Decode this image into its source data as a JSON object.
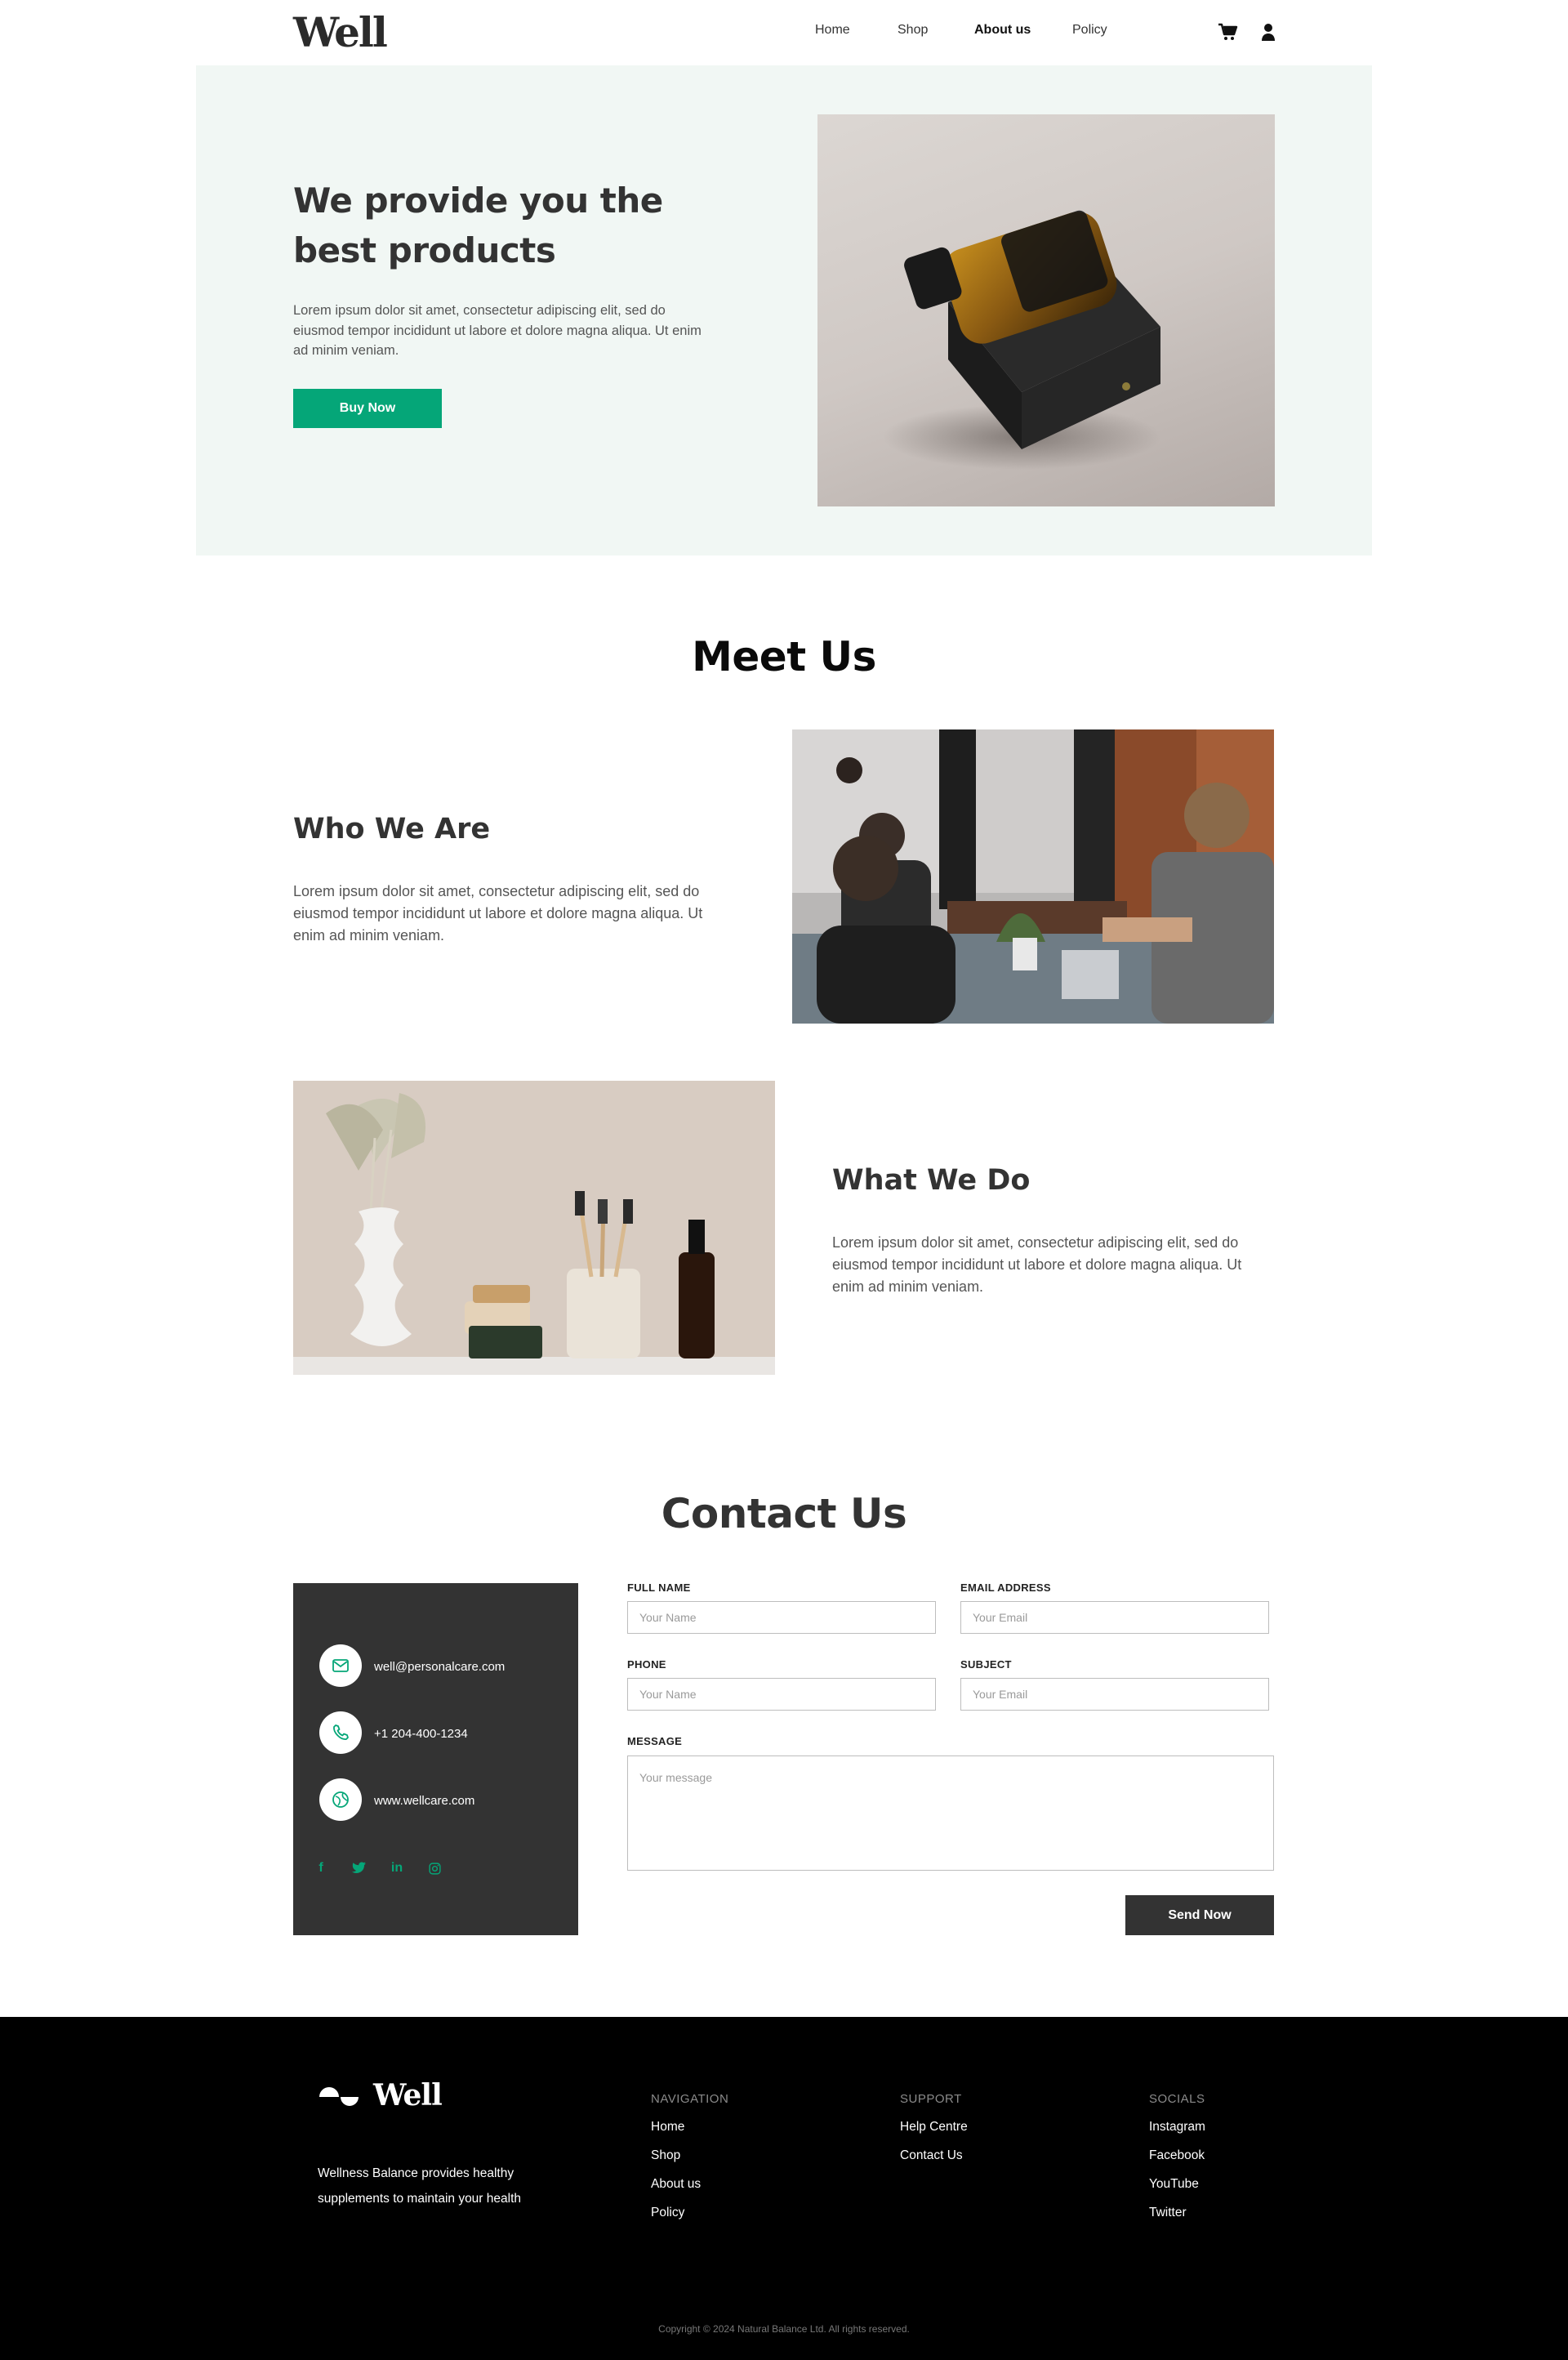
{
  "header": {
    "logo": "Well",
    "nav": [
      "Home",
      "Shop",
      "About us",
      "Policy"
    ],
    "active_nav": "About us",
    "icons": [
      "cart-icon",
      "user-icon"
    ]
  },
  "hero": {
    "title": "We provide you the best products",
    "text": "Lorem ipsum dolor sit amet, consectetur adipiscing elit, sed do eiusmod tempor incididunt ut labore et dolore magna aliqua. Ut enim ad minim veniam.",
    "button": "Buy Now",
    "slides_total": 3,
    "active_slide": 1
  },
  "meet": {
    "title": "Meet Us",
    "who": {
      "title": "Who We Are",
      "text": "Lorem ipsum dolor sit amet, consectetur adipiscing elit, sed do eiusmod tempor incididunt ut labore et dolore magna aliqua. Ut enim ad minim veniam."
    },
    "what": {
      "title": "What We Do",
      "text": "Lorem ipsum dolor sit amet, consectetur adipiscing elit, sed do eiusmod tempor incididunt ut labore et dolore magna aliqua. Ut enim ad minim veniam."
    }
  },
  "contact": {
    "title": "Contact Us",
    "email": "well@personalcare.com",
    "phone": "+1 204-400-1234",
    "website": "www.wellcare.com",
    "socials": [
      "facebook-icon",
      "twitter-icon",
      "linkedin-icon",
      "instagram-icon"
    ],
    "form": {
      "full_name_label": "FULL NAME",
      "full_name_placeholder": "Your Name",
      "email_label": "EMAIL ADDRESS",
      "email_placeholder": "Your Email",
      "phone_label": "PHONE",
      "phone_placeholder": "Your Name",
      "subject_label": "SUBJECT",
      "subject_placeholder": "Your Email",
      "message_label": "MESSAGE",
      "message_placeholder": "Your message",
      "send": "Send Now"
    }
  },
  "footer": {
    "logo": "Well",
    "description": "Wellness Balance provides healthy supplements to maintain your health",
    "navigation": {
      "title": "NAVIGATION",
      "links": [
        "Home",
        "Shop",
        "About us",
        "Policy"
      ]
    },
    "support": {
      "title": "SUPPORT",
      "links": [
        "Help Centre",
        "Contact Us"
      ]
    },
    "socials": {
      "title": "SOCIALS",
      "links": [
        "Instagram",
        "Facebook",
        "YouTube",
        "Twitter"
      ]
    },
    "copyright": "Copyright © 2024 Natural Balance Ltd. All rights reserved."
  },
  "colors": {
    "accent": "#05a678",
    "dark": "#333333",
    "hero_bg": "#f1f7f4",
    "footer_bg": "#000000"
  }
}
